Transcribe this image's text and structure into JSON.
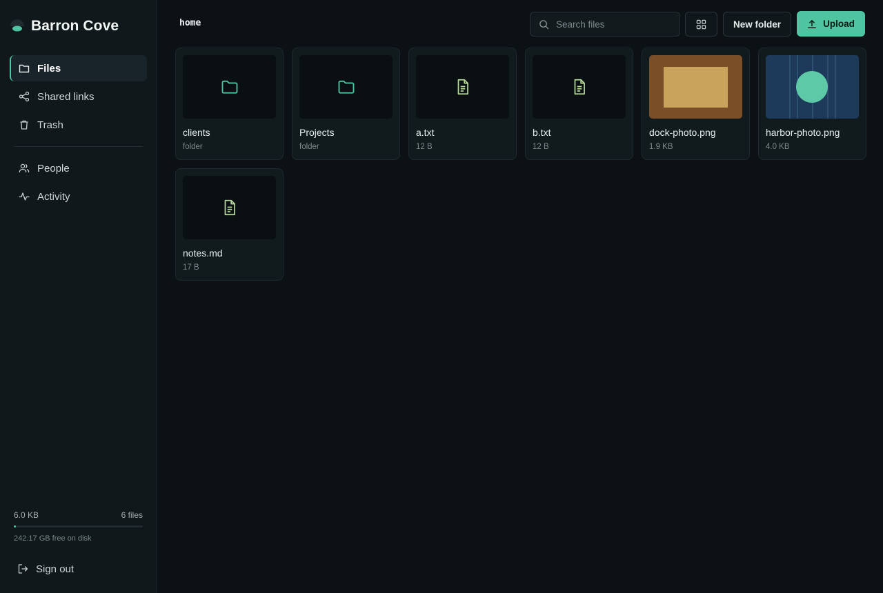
{
  "brand": {
    "name": "Barron Cove"
  },
  "sidebar": {
    "items": [
      {
        "label": "Files",
        "icon": "folder-icon",
        "active": true
      },
      {
        "label": "Shared links",
        "icon": "share-icon",
        "active": false
      },
      {
        "label": "Trash",
        "icon": "trash-icon",
        "active": false
      }
    ],
    "items2": [
      {
        "label": "People",
        "icon": "people-icon"
      },
      {
        "label": "Activity",
        "icon": "activity-icon"
      }
    ],
    "storage": {
      "used": "6.0 KB",
      "count": "6 files",
      "free": "242.17 GB free on disk",
      "fill_fraction": 0.01
    },
    "signout": "Sign out"
  },
  "header": {
    "breadcrumb": "home",
    "search_placeholder": "Search files",
    "new_folder": "New folder",
    "upload": "Upload"
  },
  "files": [
    {
      "name": "clients",
      "meta": "folder",
      "kind": "folder"
    },
    {
      "name": "Projects",
      "meta": "folder",
      "kind": "folder"
    },
    {
      "name": "a.txt",
      "meta": "12 B",
      "kind": "doc"
    },
    {
      "name": "b.txt",
      "meta": "12 B",
      "kind": "doc"
    },
    {
      "name": "dock-photo.png",
      "meta": "1.9 KB",
      "kind": "image-dock"
    },
    {
      "name": "harbor-photo.png",
      "meta": "4.0 KB",
      "kind": "image-harbor"
    },
    {
      "name": "notes.md",
      "meta": "17 B",
      "kind": "doc"
    }
  ],
  "colors": {
    "accent": "#4ec4a0",
    "background": "#0b1114",
    "sidebar": "#10181b",
    "doc_icon": "#b7d99a"
  }
}
